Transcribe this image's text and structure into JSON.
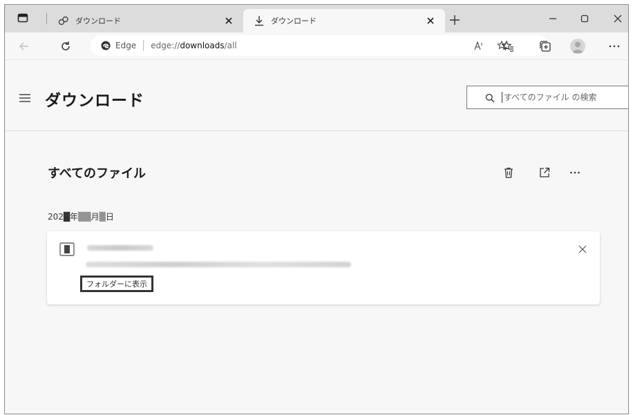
{
  "tabs": [
    {
      "title": "ダウンロード",
      "icon": "link-icon",
      "active": false
    },
    {
      "title": "ダウンロード",
      "icon": "download-arrow-icon",
      "active": true
    }
  ],
  "toolbar": {
    "address_label": "Edge",
    "url_prefix": "edge://",
    "url_host": "downloads",
    "url_rest": "/all"
  },
  "header": {
    "title": "ダウンロード",
    "search_placeholder": "すべてのファイル の検索"
  },
  "content": {
    "section_title": "すべてのファイル",
    "date_label": "202█年▒▒月▒日",
    "downloads": [
      {
        "file_name": "██████████",
        "file_url": "████████████████████████████████████████",
        "show_in_folder_label": "フォルダーに表示"
      }
    ]
  },
  "colors": {
    "tabstrip_bg": "#dcdcdc",
    "page_bg": "#f7f7f7",
    "card_bg": "#ffffff",
    "highlight_border": "#333333"
  }
}
